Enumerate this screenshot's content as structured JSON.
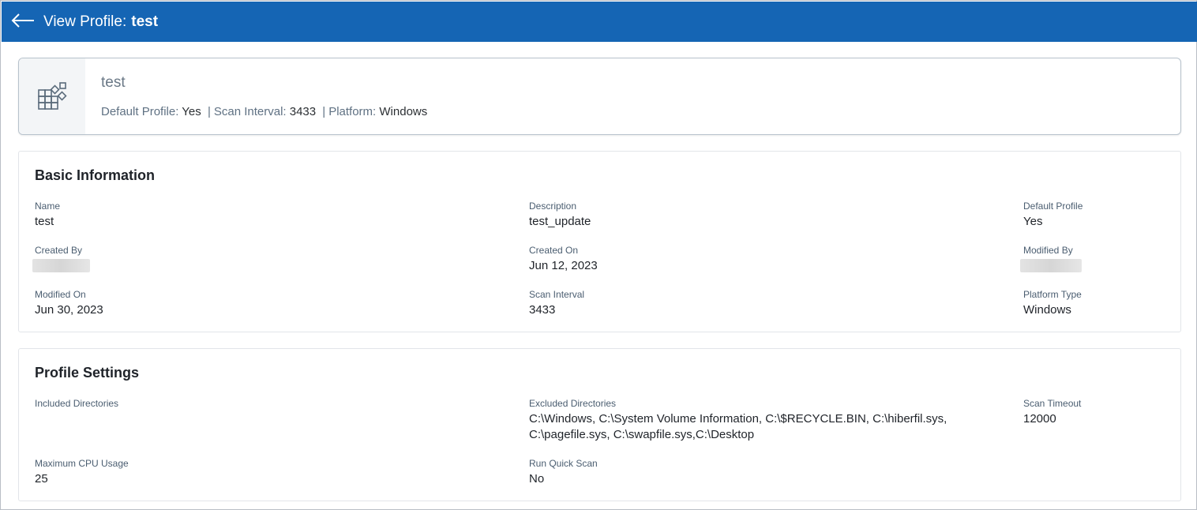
{
  "header": {
    "title_label": "View Profile:",
    "title_value": "test",
    "back_icon": "arrow-left-icon"
  },
  "summary": {
    "icon": "profile-grid-icon",
    "name": "test",
    "default_profile_label": "Default Profile:",
    "default_profile_value": "Yes",
    "scan_interval_label": "Scan Interval:",
    "scan_interval_value": "3433",
    "platform_label": "Platform:",
    "platform_value": "Windows",
    "separator": "|"
  },
  "basic_info": {
    "title": "Basic Information",
    "name_label": "Name",
    "name_value": "test",
    "description_label": "Description",
    "description_value": "test_update",
    "default_profile_label": "Default Profile",
    "default_profile_value": "Yes",
    "created_by_label": "Created By",
    "created_on_label": "Created On",
    "created_on_value": "Jun 12, 2023",
    "modified_by_label": "Modified By",
    "modified_on_label": "Modified On",
    "modified_on_value": "Jun 30, 2023",
    "scan_interval_label": "Scan Interval",
    "scan_interval_value": "3433",
    "platform_type_label": "Platform Type",
    "platform_type_value": "Windows"
  },
  "profile_settings": {
    "title": "Profile Settings",
    "included_dirs_label": "Included Directories",
    "excluded_dirs_label": "Excluded Directories",
    "excluded_dirs_line1": "C:\\Windows, C:\\System Volume Information, C:\\$RECYCLE.BIN, C:\\hiberfil.sys,",
    "excluded_dirs_line2": "C:\\pagefile.sys, C:\\swapfile.sys,C:\\Desktop",
    "scan_timeout_label": "Scan Timeout",
    "scan_timeout_value": "12000",
    "max_cpu_label": "Maximum CPU Usage",
    "max_cpu_value": "25",
    "quick_scan_label": "Run Quick Scan",
    "quick_scan_value": "No"
  },
  "colors": {
    "header_bg": "#1565b4",
    "label": "#4a5d70",
    "summary_label": "#5f7183"
  }
}
